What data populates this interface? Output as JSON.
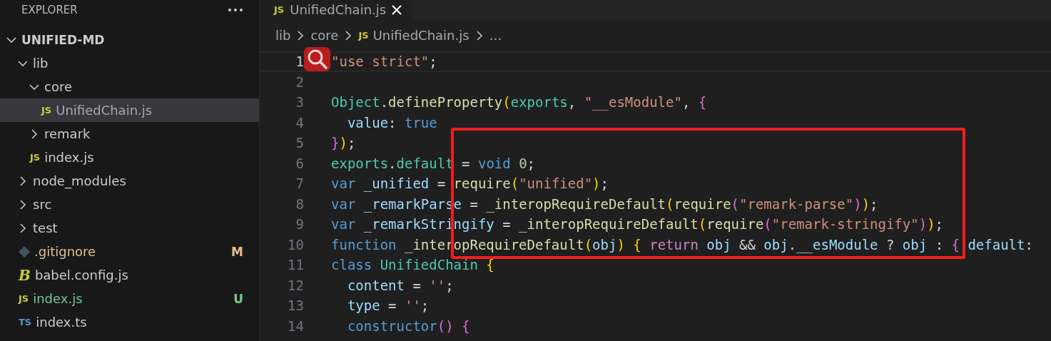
{
  "sidebar": {
    "title": "EXPLORER",
    "root": {
      "label": "UNIFIED-MD",
      "expanded": true
    },
    "items": [
      {
        "label": "lib",
        "kind": "folder",
        "expanded": true,
        "selected": false,
        "children": [
          {
            "label": "core",
            "kind": "folder",
            "expanded": true,
            "selected": false,
            "children": [
              {
                "label": "UnifiedChain.js",
                "kind": "file",
                "icon": {
                  "kind": "js",
                  "text": "JS"
                },
                "selected": true
              }
            ]
          },
          {
            "label": "remark",
            "kind": "folder",
            "expanded": false,
            "selected": false
          },
          {
            "label": "index.js",
            "kind": "file",
            "icon": {
              "kind": "js",
              "text": "JS"
            },
            "selected": false
          }
        ]
      },
      {
        "label": "node_modules",
        "kind": "folder",
        "expanded": false,
        "selected": false
      },
      {
        "label": "src",
        "kind": "folder",
        "expanded": false,
        "selected": false
      },
      {
        "label": "test",
        "kind": "folder",
        "expanded": false,
        "selected": false
      },
      {
        "label": ".gitignore",
        "kind": "file",
        "icon": {
          "kind": "git"
        },
        "selected": false,
        "color": "#e2c08d",
        "badge": "M"
      },
      {
        "label": "babel.config.js",
        "kind": "file",
        "icon": {
          "kind": "babel",
          "text": "B"
        },
        "selected": false
      },
      {
        "label": "index.js",
        "kind": "file",
        "icon": {
          "kind": "js",
          "text": "JS"
        },
        "selected": false,
        "color": "#73c991",
        "badge": "U"
      },
      {
        "label": "index.ts",
        "kind": "file",
        "icon": {
          "kind": "ts",
          "text": "TS"
        },
        "selected": false
      }
    ]
  },
  "tabs": [
    {
      "label": "UnifiedChain.js",
      "icon": {
        "kind": "js",
        "text": "JS"
      },
      "selected": true
    }
  ],
  "breadcrumb": [
    {
      "label": "lib"
    },
    {
      "label": "core"
    },
    {
      "label": "UnifiedChain.js",
      "icon": {
        "kind": "js",
        "text": "JS"
      }
    },
    {
      "label": "…"
    }
  ],
  "editor": {
    "lines": [
      {
        "number": "1",
        "current": true,
        "tokens": [
          {
            "text": "\"use strict\"",
            "kind": "str"
          },
          {
            "text": ";",
            "kind": "p"
          }
        ]
      },
      {
        "number": "2",
        "current": false
      },
      {
        "number": "3",
        "current": false,
        "tokens": [
          {
            "text": "Object",
            "kind": "type"
          },
          {
            "text": ".",
            "kind": "p"
          },
          {
            "text": "defineProperty",
            "kind": "fn"
          },
          {
            "text": "(",
            "kind": "b1"
          },
          {
            "text": "exports",
            "kind": "type"
          },
          {
            "text": ", ",
            "kind": "p"
          },
          {
            "text": "\"__esModule\"",
            "kind": "str"
          },
          {
            "text": ", ",
            "kind": "p"
          },
          {
            "text": "{",
            "kind": "b2"
          }
        ]
      },
      {
        "number": "4",
        "current": false,
        "tokens": [
          {
            "text": "  value",
            "kind": "var"
          },
          {
            "text": ": ",
            "kind": "p"
          },
          {
            "text": "true",
            "kind": "kw"
          }
        ]
      },
      {
        "number": "5",
        "current": false,
        "tokens": [
          {
            "text": "}",
            "kind": "b2"
          },
          {
            "text": ")",
            "kind": "b1"
          },
          {
            "text": ";",
            "kind": "p"
          }
        ]
      },
      {
        "number": "6",
        "current": false,
        "tokens": [
          {
            "text": "exports",
            "kind": "type"
          },
          {
            "text": ".",
            "kind": "p"
          },
          {
            "text": "default",
            "kind": "type"
          },
          {
            "text": " = ",
            "kind": "p"
          },
          {
            "text": "void ",
            "kind": "kw"
          },
          {
            "text": "0",
            "kind": "num"
          },
          {
            "text": ";",
            "kind": "p"
          }
        ]
      },
      {
        "number": "7",
        "current": false,
        "tokens": [
          {
            "text": "var ",
            "kind": "kw"
          },
          {
            "text": "_unified",
            "kind": "var"
          },
          {
            "text": " = ",
            "kind": "p"
          },
          {
            "text": "require",
            "kind": "fn"
          },
          {
            "text": "(",
            "kind": "b1"
          },
          {
            "text": "\"unified\"",
            "kind": "str"
          },
          {
            "text": ")",
            "kind": "b1"
          },
          {
            "text": ";",
            "kind": "p"
          }
        ]
      },
      {
        "number": "8",
        "current": false,
        "tokens": [
          {
            "text": "var ",
            "kind": "kw"
          },
          {
            "text": "_remarkParse",
            "kind": "var"
          },
          {
            "text": " = ",
            "kind": "p"
          },
          {
            "text": "_interopRequireDefault",
            "kind": "fn"
          },
          {
            "text": "(",
            "kind": "b1"
          },
          {
            "text": "require",
            "kind": "fn"
          },
          {
            "text": "(",
            "kind": "b2"
          },
          {
            "text": "\"remark-parse\"",
            "kind": "str"
          },
          {
            "text": ")",
            "kind": "b2"
          },
          {
            "text": ")",
            "kind": "b1"
          },
          {
            "text": ";",
            "kind": "p"
          }
        ]
      },
      {
        "number": "9",
        "current": false,
        "tokens": [
          {
            "text": "var ",
            "kind": "kw"
          },
          {
            "text": "_remarkStringify",
            "kind": "var"
          },
          {
            "text": " = ",
            "kind": "p"
          },
          {
            "text": "_interopRequireDefault",
            "kind": "fn"
          },
          {
            "text": "(",
            "kind": "b1"
          },
          {
            "text": "require",
            "kind": "fn"
          },
          {
            "text": "(",
            "kind": "b2"
          },
          {
            "text": "\"remark-stringify\"",
            "kind": "str"
          },
          {
            "text": ")",
            "kind": "b2"
          },
          {
            "text": ")",
            "kind": "b1"
          },
          {
            "text": ";",
            "kind": "p"
          }
        ]
      },
      {
        "number": "10",
        "current": false,
        "tokens": [
          {
            "text": "function ",
            "kind": "kw"
          },
          {
            "text": "_interopRequireDefault",
            "kind": "fn"
          },
          {
            "text": "(",
            "kind": "b1"
          },
          {
            "text": "obj",
            "kind": "var"
          },
          {
            "text": ")",
            "kind": "b1"
          },
          {
            "text": " { ",
            "kind": "b1"
          },
          {
            "text": "return ",
            "kind": "ctl"
          },
          {
            "text": "obj",
            "kind": "var"
          },
          {
            "text": " && ",
            "kind": "p"
          },
          {
            "text": "obj",
            "kind": "var"
          },
          {
            "text": ".",
            "kind": "p"
          },
          {
            "text": "__esModule",
            "kind": "var"
          },
          {
            "text": " ? ",
            "kind": "p"
          },
          {
            "text": "obj",
            "kind": "var"
          },
          {
            "text": " : ",
            "kind": "p"
          },
          {
            "text": "{ ",
            "kind": "b2"
          },
          {
            "text": "default",
            "kind": "var"
          },
          {
            "text": ":",
            "kind": "p"
          }
        ]
      },
      {
        "number": "11",
        "current": false,
        "tokens": [
          {
            "text": "class ",
            "kind": "kw"
          },
          {
            "text": "UnifiedChain",
            "kind": "type"
          },
          {
            "text": " {",
            "kind": "b1"
          }
        ]
      },
      {
        "number": "12",
        "current": false,
        "tokens": [
          {
            "text": "  content",
            "kind": "var"
          },
          {
            "text": " = ",
            "kind": "p"
          },
          {
            "text": "''",
            "kind": "str"
          },
          {
            "text": ";",
            "kind": "p"
          }
        ]
      },
      {
        "number": "13",
        "current": false,
        "tokens": [
          {
            "text": "  type",
            "kind": "var"
          },
          {
            "text": " = ",
            "kind": "p"
          },
          {
            "text": "''",
            "kind": "str"
          },
          {
            "text": ";",
            "kind": "p"
          }
        ]
      },
      {
        "number": "14",
        "current": false,
        "tokens": [
          {
            "text": "  constructor",
            "kind": "kw"
          },
          {
            "text": "()",
            "kind": "b2"
          },
          {
            "text": " {",
            "kind": "b2"
          }
        ]
      }
    ]
  }
}
